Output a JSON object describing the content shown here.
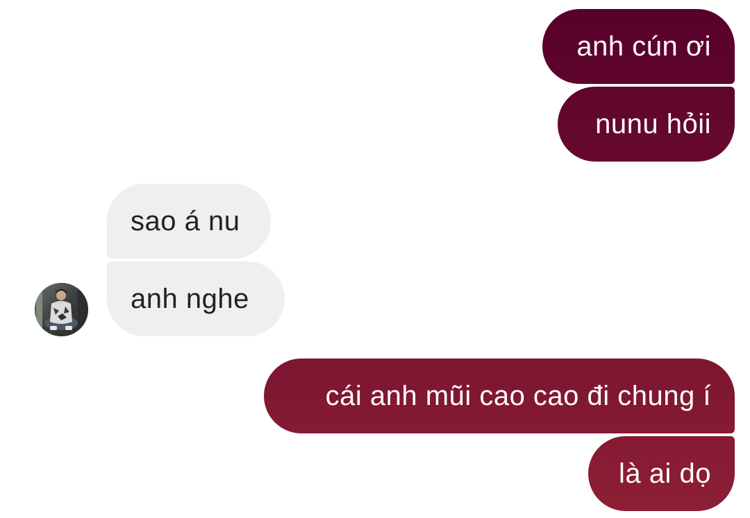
{
  "chat": {
    "colors": {
      "outgoing_top": "#56002a",
      "outgoing_bottom": "#8e1f35",
      "incoming_bg": "#efefef",
      "incoming_text": "#222222"
    },
    "messages": [
      {
        "direction": "outgoing",
        "text": "anh cún ơi"
      },
      {
        "direction": "outgoing",
        "text": "nunu hỏii"
      },
      {
        "direction": "incoming",
        "text": "sao á nu"
      },
      {
        "direction": "incoming",
        "text": "anh nghe"
      },
      {
        "direction": "outgoing",
        "text": "cái anh mũi cao cao đi chung í"
      },
      {
        "direction": "outgoing",
        "text": "là ai dọ"
      }
    ],
    "contact": {
      "avatar_icon": "user-avatar-photo"
    }
  }
}
